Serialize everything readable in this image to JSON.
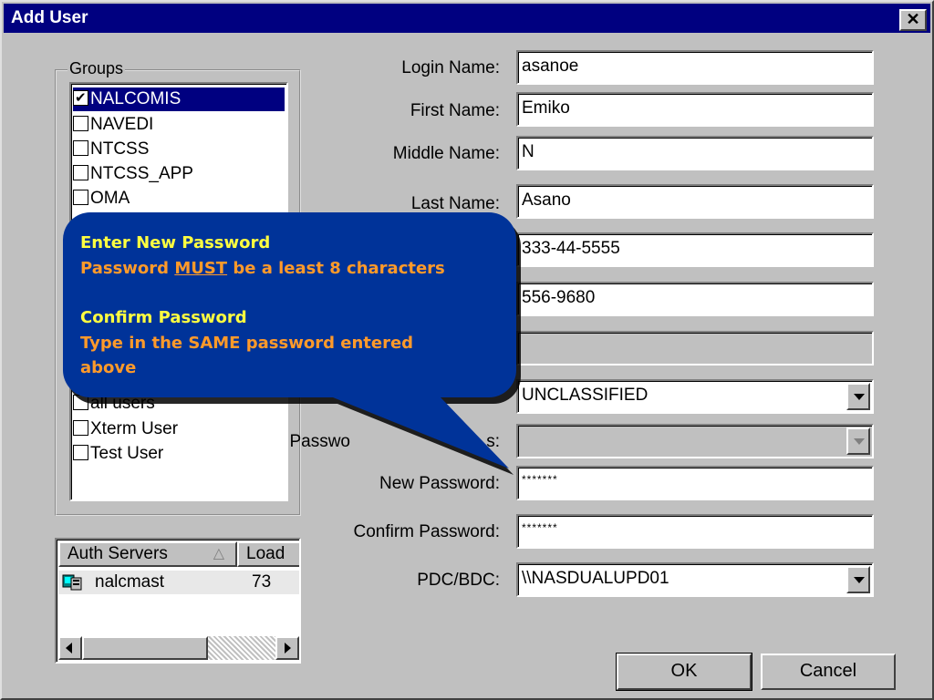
{
  "window": {
    "title": "Add User",
    "close_glyph": "✕"
  },
  "groups": {
    "legend": "Groups",
    "items": [
      {
        "label": "NALCOMIS",
        "checked": true,
        "selected": true
      },
      {
        "label": "NAVEDI",
        "checked": false
      },
      {
        "label": "NTCSS",
        "checked": false
      },
      {
        "label": "NTCSS_APP",
        "checked": false
      },
      {
        "label": "OMA",
        "checked": false
      }
    ]
  },
  "user_types": {
    "items": [
      {
        "label": "all users",
        "checked": false
      },
      {
        "label": "Xterm User",
        "checked": false
      },
      {
        "label": "Test User",
        "checked": false
      }
    ]
  },
  "auth_servers": {
    "headers": [
      "Auth Servers",
      "Load"
    ],
    "sort_glyph": "△",
    "rows": [
      {
        "server": "nalcmast",
        "load": "73",
        "icon": "server-icon"
      }
    ]
  },
  "form": {
    "login_name": {
      "label": "Login Name:",
      "value": "asanoe"
    },
    "first_name": {
      "label": "First Name:",
      "value": "Emiko"
    },
    "middle_name": {
      "label": "Middle Name:",
      "value": "N"
    },
    "last_name": {
      "label": "Last Name:",
      "value": "Asano"
    },
    "ssn": {
      "value": "333-44-5555"
    },
    "phone": {
      "value": "556-9680"
    },
    "blank": {
      "value": ""
    },
    "classification": {
      "value": "UNCLASSIFIED"
    },
    "password_status": {
      "label_a": "Passwo",
      "label_b": "s:",
      "value": ""
    },
    "new_password": {
      "label": "New Password:",
      "value": "*******"
    },
    "confirm_password": {
      "label": "Confirm Password:",
      "value": "*******"
    },
    "pdc_bdc": {
      "label": "PDC/BDC:",
      "value": "\\\\NASDUALUPD01"
    }
  },
  "buttons": {
    "ok": "OK",
    "cancel": "Cancel"
  },
  "callout": {
    "heading1": "Enter New Password",
    "line1_pre": "Password ",
    "line1_emph": "MUST",
    "line1_post": " be a least 8 characters",
    "heading2": "Confirm Password",
    "line2": "Type in the SAME password entered above",
    "colors": {
      "fill": "#003399",
      "heading": "#ffff40",
      "body": "#ff9a2a"
    }
  }
}
